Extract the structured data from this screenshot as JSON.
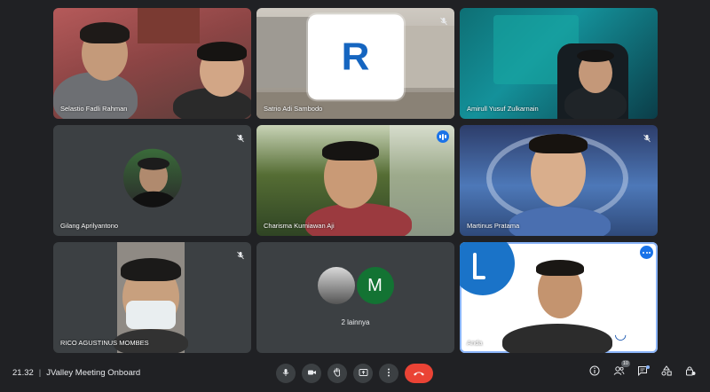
{
  "participants": [
    {
      "name": "Selastio Fadli Rahman",
      "muted": false
    },
    {
      "name": "Satrio Adi Sambodo",
      "muted": true,
      "avatar_letter": "R"
    },
    {
      "name": "Amirull Yusuf Zulkarnain",
      "muted": false
    },
    {
      "name": "Gilang Aprilyantono",
      "muted": true
    },
    {
      "name": "Charisma Kurniawan Aji",
      "speaking": true
    },
    {
      "name": "Martinus Pratama",
      "muted": true
    },
    {
      "name": "RICO AGUSTINUS MOMBES",
      "muted": true
    },
    {
      "name": "",
      "others_label": "2 lainnya",
      "avatar_letter": "M"
    },
    {
      "name": "Anda",
      "more_options": true
    }
  ],
  "meeting": {
    "time": "21.32",
    "title": "JValley Meeting Onboard"
  },
  "controls": [
    "mic-icon",
    "camera-icon",
    "raise-hand-icon",
    "present-icon",
    "more-options-icon",
    "end-call-icon"
  ],
  "right_panel": {
    "people_count": "10",
    "icons": [
      "info-icon",
      "people-icon",
      "chat-icon",
      "activities-icon",
      "host-controls-icon"
    ]
  },
  "colors": {
    "background": "#202124",
    "tile": "#3c4043",
    "end_call": "#ea4335",
    "accent": "#1a73e8",
    "others_avatar": "#137333"
  }
}
